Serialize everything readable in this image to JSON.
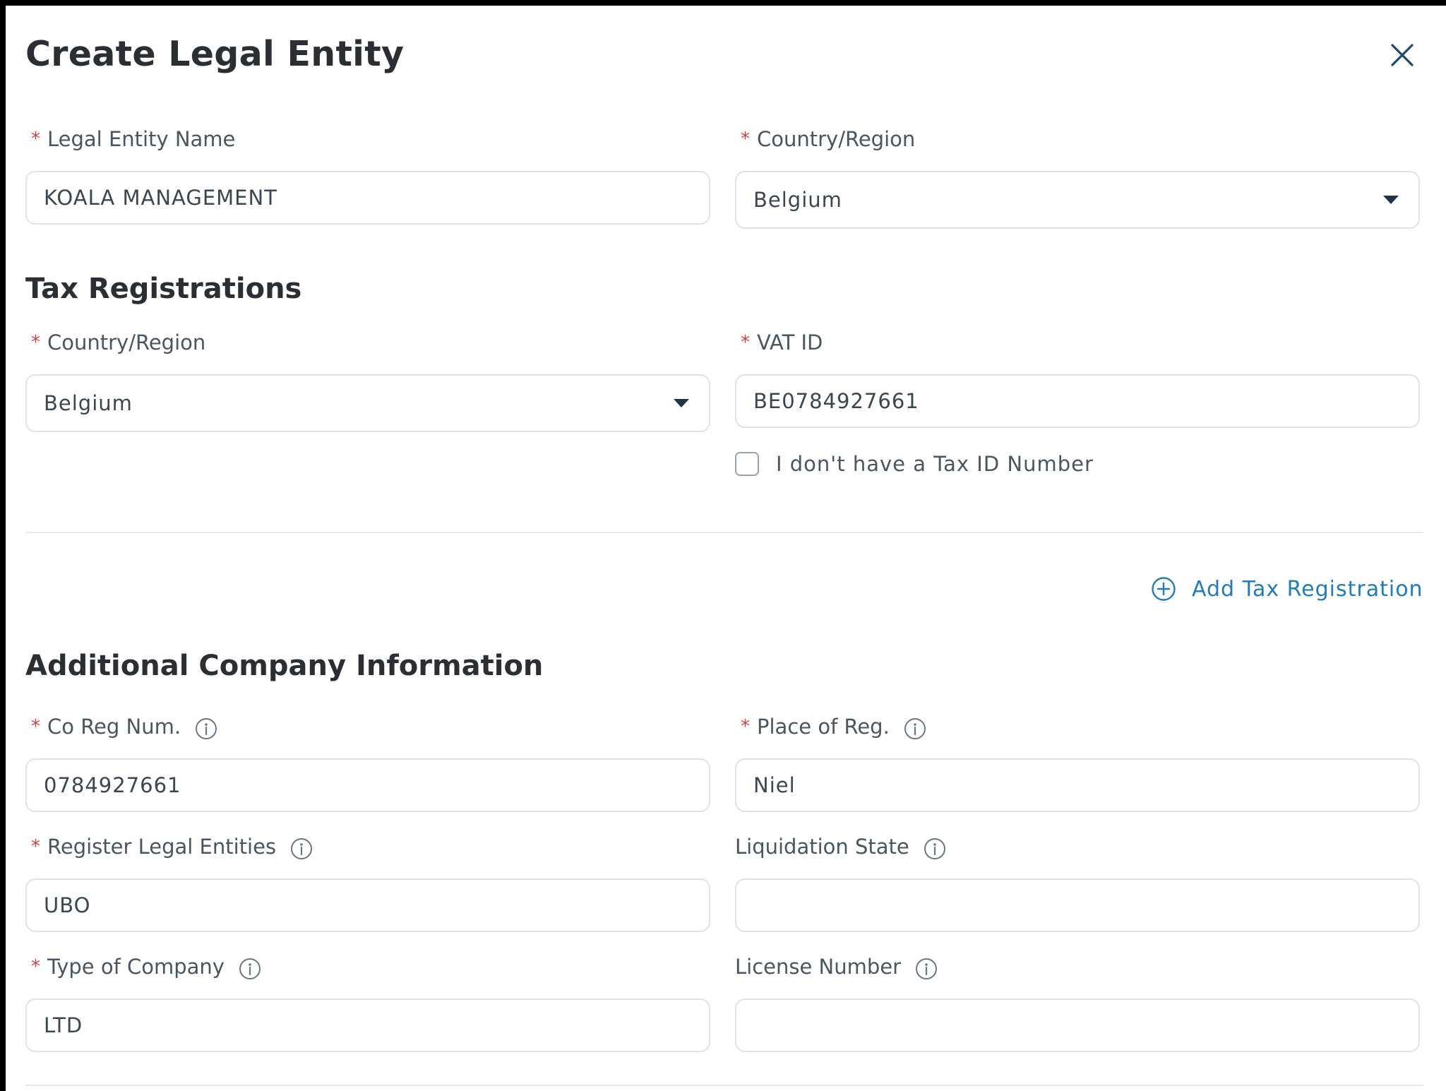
{
  "dialog": {
    "title": "Create Legal Entity"
  },
  "legal_entity": {
    "name_label": "Legal Entity Name",
    "name_value": "KOALA MANAGEMENT",
    "country_label": "Country/Region",
    "country_value": "Belgium"
  },
  "tax": {
    "section_title": "Tax Registrations",
    "country_label": "Country/Region",
    "country_value": "Belgium",
    "vat_label": "VAT ID",
    "vat_value": "BE0784927661",
    "no_tax_checkbox_label": "I don't have a Tax ID Number",
    "no_tax_checked": false,
    "add_link": "Add Tax Registration"
  },
  "company": {
    "section_title": "Additional Company Information",
    "co_reg_label": "Co Reg Num.",
    "co_reg_value": "0784927661",
    "place_label": "Place of Reg.",
    "place_value": "Niel",
    "register_label": "Register Legal Entities",
    "register_value": "UBO",
    "liquidation_label": "Liquidation State",
    "liquidation_value": "",
    "type_label": "Type of Company",
    "type_value": "LTD",
    "license_label": "License Number",
    "license_value": ""
  },
  "colors": {
    "required": "#d23f3f",
    "link": "#1f7cc0",
    "border": "#dfe3e7"
  },
  "required_marker": "*"
}
